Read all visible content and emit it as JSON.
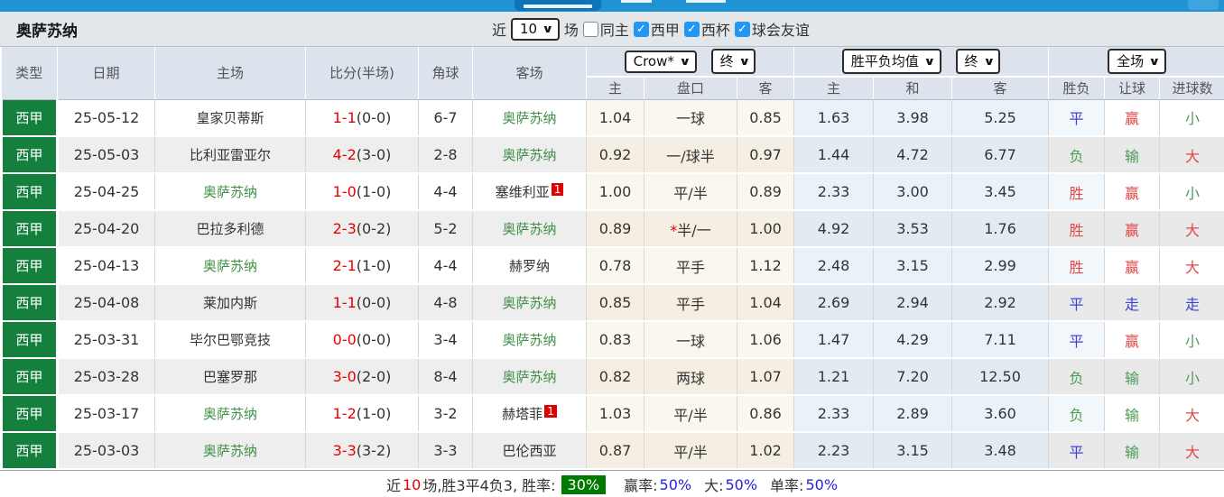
{
  "team_header": {
    "team_name": "奥萨苏纳",
    "recent_label": "近",
    "matches_count": "10",
    "matches_label": "场",
    "filters": [
      {
        "label": "同主",
        "checked": false
      },
      {
        "label": "西甲",
        "checked": true
      },
      {
        "label": "西杯",
        "checked": true
      },
      {
        "label": "球会友谊",
        "checked": true
      }
    ]
  },
  "table": {
    "columns": [
      "类型",
      "日期",
      "主场",
      "比分(半场)",
      "角球",
      "客场"
    ],
    "dropdowns": {
      "asian_source": "Crow*",
      "asian_time": "终",
      "euro_source": "胜平负均值",
      "euro_time": "终",
      "result_scope": "全场"
    },
    "sub_columns": [
      "主",
      "盘口",
      "客",
      "主",
      "和",
      "客",
      "胜负",
      "让球",
      "进球数"
    ],
    "rows": [
      {
        "league": "西甲",
        "date": "25-05-12",
        "home": "皇家贝蒂斯",
        "home_osa": false,
        "ft": "1-1",
        "ht": "(0-0)",
        "corners": "6-7",
        "away": "奥萨苏纳",
        "away_osa": true,
        "away_red": "",
        "ah_h": "1.04",
        "handicap": "一球",
        "star": false,
        "ah_a": "0.85",
        "eu_h": "1.63",
        "eu_d": "3.98",
        "eu_a": "5.25",
        "r_wdl": "平",
        "r_wdl_c": "blue",
        "r_let": "赢",
        "r_let_c": "red",
        "r_goal": "小",
        "r_goal_c": "green"
      },
      {
        "league": "西甲",
        "date": "25-05-03",
        "home": "比利亚雷亚尔",
        "home_osa": false,
        "ft": "4-2",
        "ht": "(3-0)",
        "corners": "2-8",
        "away": "奥萨苏纳",
        "away_osa": true,
        "away_red": "",
        "ah_h": "0.92",
        "handicap": "一/球半",
        "star": false,
        "ah_a": "0.97",
        "eu_h": "1.44",
        "eu_d": "4.72",
        "eu_a": "6.77",
        "r_wdl": "负",
        "r_wdl_c": "green",
        "r_let": "输",
        "r_let_c": "green",
        "r_goal": "大",
        "r_goal_c": "red"
      },
      {
        "league": "西甲",
        "date": "25-04-25",
        "home": "奥萨苏纳",
        "home_osa": true,
        "ft": "1-0",
        "ht": "(1-0)",
        "corners": "4-4",
        "away": "塞维利亚",
        "away_osa": false,
        "away_red": "1",
        "ah_h": "1.00",
        "handicap": "平/半",
        "star": false,
        "ah_a": "0.89",
        "eu_h": "2.33",
        "eu_d": "3.00",
        "eu_a": "3.45",
        "r_wdl": "胜",
        "r_wdl_c": "red",
        "r_let": "赢",
        "r_let_c": "red",
        "r_goal": "小",
        "r_goal_c": "green"
      },
      {
        "league": "西甲",
        "date": "25-04-20",
        "home": "巴拉多利德",
        "home_osa": false,
        "ft": "2-3",
        "ht": "(0-2)",
        "corners": "5-2",
        "away": "奥萨苏纳",
        "away_osa": true,
        "away_red": "",
        "ah_h": "0.89",
        "handicap": "半/一",
        "star": true,
        "ah_a": "1.00",
        "eu_h": "4.92",
        "eu_d": "3.53",
        "eu_a": "1.76",
        "r_wdl": "胜",
        "r_wdl_c": "red",
        "r_let": "赢",
        "r_let_c": "red",
        "r_goal": "大",
        "r_goal_c": "red"
      },
      {
        "league": "西甲",
        "date": "25-04-13",
        "home": "奥萨苏纳",
        "home_osa": true,
        "ft": "2-1",
        "ht": "(1-0)",
        "corners": "4-4",
        "away": "赫罗纳",
        "away_osa": false,
        "away_red": "",
        "ah_h": "0.78",
        "handicap": "平手",
        "star": false,
        "ah_a": "1.12",
        "eu_h": "2.48",
        "eu_d": "3.15",
        "eu_a": "2.99",
        "r_wdl": "胜",
        "r_wdl_c": "red",
        "r_let": "赢",
        "r_let_c": "red",
        "r_goal": "大",
        "r_goal_c": "red"
      },
      {
        "league": "西甲",
        "date": "25-04-08",
        "home": "莱加内斯",
        "home_osa": false,
        "ft": "1-1",
        "ht": "(0-0)",
        "corners": "4-8",
        "away": "奥萨苏纳",
        "away_osa": true,
        "away_red": "",
        "ah_h": "0.85",
        "handicap": "平手",
        "star": false,
        "ah_a": "1.04",
        "eu_h": "2.69",
        "eu_d": "2.94",
        "eu_a": "2.92",
        "r_wdl": "平",
        "r_wdl_c": "blue",
        "r_let": "走",
        "r_let_c": "blue",
        "r_goal": "走",
        "r_goal_c": "blue"
      },
      {
        "league": "西甲",
        "date": "25-03-31",
        "home": "毕尔巴鄂竞技",
        "home_osa": false,
        "ft": "0-0",
        "ht": "(0-0)",
        "corners": "3-4",
        "away": "奥萨苏纳",
        "away_osa": true,
        "away_red": "",
        "ah_h": "0.83",
        "handicap": "一球",
        "star": false,
        "ah_a": "1.06",
        "eu_h": "1.47",
        "eu_d": "4.29",
        "eu_a": "7.11",
        "r_wdl": "平",
        "r_wdl_c": "blue",
        "r_let": "赢",
        "r_let_c": "red",
        "r_goal": "小",
        "r_goal_c": "green"
      },
      {
        "league": "西甲",
        "date": "25-03-28",
        "home": "巴塞罗那",
        "home_osa": false,
        "ft": "3-0",
        "ht": "(2-0)",
        "corners": "8-4",
        "away": "奥萨苏纳",
        "away_osa": true,
        "away_red": "",
        "ah_h": "0.82",
        "handicap": "两球",
        "star": false,
        "ah_a": "1.07",
        "eu_h": "1.21",
        "eu_d": "7.20",
        "eu_a": "12.50",
        "r_wdl": "负",
        "r_wdl_c": "green",
        "r_let": "输",
        "r_let_c": "green",
        "r_goal": "小",
        "r_goal_c": "green"
      },
      {
        "league": "西甲",
        "date": "25-03-17",
        "home": "奥萨苏纳",
        "home_osa": true,
        "ft": "1-2",
        "ht": "(1-0)",
        "corners": "3-2",
        "away": "赫塔菲",
        "away_osa": false,
        "away_red": "1",
        "ah_h": "1.03",
        "handicap": "平/半",
        "star": false,
        "ah_a": "0.86",
        "eu_h": "2.33",
        "eu_d": "2.89",
        "eu_a": "3.60",
        "r_wdl": "负",
        "r_wdl_c": "green",
        "r_let": "输",
        "r_let_c": "green",
        "r_goal": "大",
        "r_goal_c": "red"
      },
      {
        "league": "西甲",
        "date": "25-03-03",
        "home": "奥萨苏纳",
        "home_osa": true,
        "ft": "3-3",
        "ht": "(3-2)",
        "corners": "3-3",
        "away": "巴伦西亚",
        "away_osa": false,
        "away_red": "",
        "ah_h": "0.87",
        "handicap": "平/半",
        "star": false,
        "ah_a": "1.02",
        "eu_h": "2.23",
        "eu_d": "3.15",
        "eu_a": "3.48",
        "r_wdl": "平",
        "r_wdl_c": "blue",
        "r_let": "输",
        "r_let_c": "green",
        "r_goal": "大",
        "r_goal_c": "red"
      }
    ]
  },
  "footer": {
    "prefix": "近",
    "count": "10",
    "summary": "场,胜3平4负3, 胜率:",
    "win_rate": "30%",
    "label_win": "赢率:",
    "win_pct": "50%",
    "label_big": "大:",
    "big_pct": "50%",
    "label_single": "单率:",
    "single_pct": "50%"
  },
  "colors": {
    "topbar_blue": "#2094d3",
    "league_green": "#15803d",
    "osasuna_green": "#3f8f46",
    "score_red": "#e60000",
    "result_red": "#e04848",
    "result_blue": "#4040d8",
    "result_green": "#4d9b57",
    "rate_chip_green": "#007a00",
    "footer_blue": "#2525dd"
  }
}
